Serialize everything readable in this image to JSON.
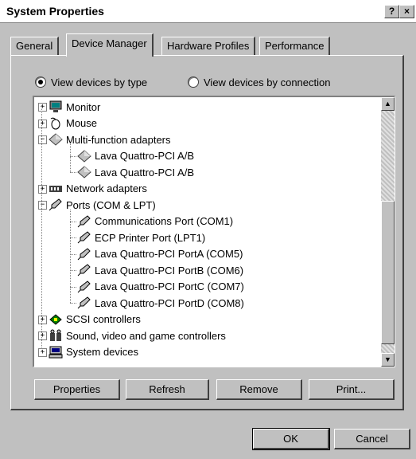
{
  "window": {
    "title": "System Properties",
    "help_glyph": "?",
    "close_glyph": "×"
  },
  "tabs": [
    {
      "label": "General"
    },
    {
      "label": "Device Manager"
    },
    {
      "label": "Hardware Profiles"
    },
    {
      "label": "Performance"
    }
  ],
  "view": {
    "by_type": "View devices by type",
    "by_connection": "View devices by connection",
    "selected": "by_type"
  },
  "tree": [
    {
      "label": "Monitor",
      "icon": "monitor-icon",
      "expand": "+"
    },
    {
      "label": "Mouse",
      "icon": "mouse-icon",
      "expand": "+"
    },
    {
      "label": "Multi-function adapters",
      "icon": "adapter-icon",
      "expand": "−"
    },
    {
      "label": "Lava Quattro-PCI A/B",
      "icon": "adapter-icon"
    },
    {
      "label": "Lava Quattro-PCI A/B",
      "icon": "adapter-icon"
    },
    {
      "label": "Network adapters",
      "icon": "network-icon",
      "expand": "+"
    },
    {
      "label": "Ports (COM & LPT)",
      "icon": "port-icon",
      "expand": "−"
    },
    {
      "label": "Communications Port (COM1)",
      "icon": "port-icon"
    },
    {
      "label": "ECP Printer Port (LPT1)",
      "icon": "port-icon"
    },
    {
      "label": "Lava Quattro-PCI PortA (COM5)",
      "icon": "port-icon"
    },
    {
      "label": "Lava Quattro-PCI PortB (COM6)",
      "icon": "port-icon"
    },
    {
      "label": "Lava Quattro-PCI PortC (COM7)",
      "icon": "port-icon"
    },
    {
      "label": "Lava Quattro-PCI PortD (COM8)",
      "icon": "port-icon"
    },
    {
      "label": "SCSI controllers",
      "icon": "scsi-icon",
      "expand": "+"
    },
    {
      "label": "Sound, video and game controllers",
      "icon": "sound-icon",
      "expand": "+"
    },
    {
      "label": "System devices",
      "icon": "computer-icon",
      "expand": "+"
    }
  ],
  "buttons": {
    "properties": "Properties",
    "refresh": "Refresh",
    "remove": "Remove",
    "print": "Print...",
    "ok": "OK",
    "cancel": "Cancel"
  }
}
